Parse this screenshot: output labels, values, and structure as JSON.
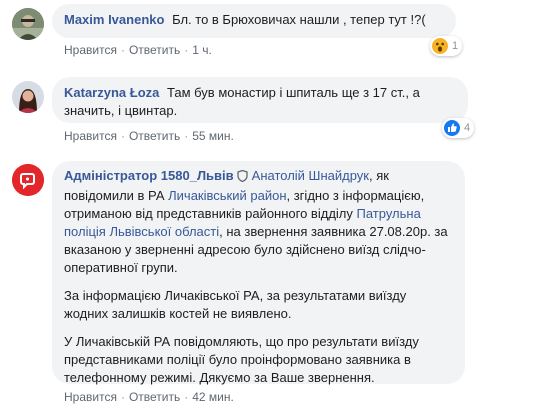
{
  "comments": [
    {
      "author": "Maxim Ivanenko",
      "text": "Бл. то в Брюховичах нашли , тепер тут !?(",
      "like_label": "Нравится",
      "reply_label": "Ответить",
      "time": "1 ч.",
      "reaction": {
        "type": "wow",
        "count": "1"
      }
    },
    {
      "author": "Katarzyna Łoza",
      "text": "Там був монастир і шпиталь ще з 17 ст., а значить, і цвинтар.",
      "like_label": "Нравится",
      "reply_label": "Ответить",
      "time": "55 мин.",
      "reaction": {
        "type": "like",
        "count": "4"
      }
    },
    {
      "author": "Адміністратор 1580_Львів",
      "mention": "Анатолій Шнайдрук",
      "p1_a": ", як повідомили в РА ",
      "link1": "Личаківський район",
      "p1_b": ", згідно з інформацією, отриманою від представників районного відділу ",
      "link2": "Патрульна поліція Львівської області",
      "p1_c": ", на звернення заявника 27.08.20р. за вказаною у зверненні адресою було здійснено виїзд слідчо-оперативної групи.",
      "p2": "За інформацією Личаківської РА, за результатами виїзду жодних залишків костей не виявлено.",
      "p3": "У Личаківській РА повідомляють, що про результати виїзду представниками поліції було проінформовано заявника в телефонному режимі. Дякуємо за Ваше звернення.",
      "like_label": "Нравится",
      "reply_label": "Ответить",
      "time": "42 мин."
    }
  ],
  "colors": {
    "link": "#385898",
    "bubble": "#f2f3f5",
    "admin_avatar": "#e2262a",
    "like_blue": "#1877f2",
    "wow_yellow": "#f7b125"
  }
}
